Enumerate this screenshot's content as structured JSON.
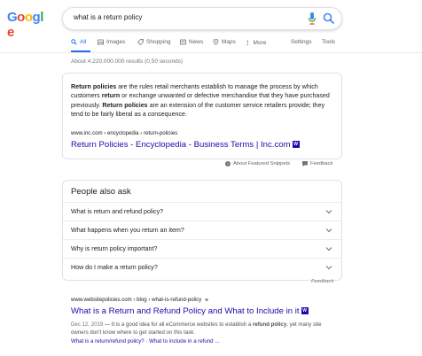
{
  "search": {
    "logo_letters": [
      {
        "ch": "G",
        "color": "#4285f4"
      },
      {
        "ch": "o",
        "color": "#ea4335"
      },
      {
        "ch": "o",
        "color": "#fbbc05"
      },
      {
        "ch": "g",
        "color": "#4285f4"
      },
      {
        "ch": "l",
        "color": "#34a853"
      },
      {
        "ch": "e",
        "color": "#ea4335"
      }
    ],
    "query": "what is a return policy"
  },
  "tabs": {
    "all": "All",
    "images": "Images",
    "shopping": "Shopping",
    "news": "News",
    "maps": "Maps",
    "more": "More",
    "settings": "Settings",
    "tools": "Tools"
  },
  "result_stats": "About 4.220.000.000 results (0,50 seconds)",
  "featured": {
    "snippet_parts": [
      {
        "text": "Return policies",
        "bold": true
      },
      {
        "text": " are the rules retail merchants establish to manage the process by which customers ",
        "bold": false
      },
      {
        "text": "return",
        "bold": true
      },
      {
        "text": " or exchange unwanted or defective merchandise that they have purchased previously. ",
        "bold": false
      },
      {
        "text": "Return policies",
        "bold": true
      },
      {
        "text": " are an extension of the customer service retailers provide; they tend to be fairly liberal as a consequence.",
        "bold": false
      }
    ],
    "cite": "www.inc.com › encyclopedia › return-policies",
    "title": "Return Policies - Encyclopedia - Business Terms | Inc.com",
    "favicon_letter": "W",
    "about_label": "About Featured Snippets",
    "feedback_label": "Feedback"
  },
  "paa": {
    "title": "People also ask",
    "questions": [
      "What is return and refund policy?",
      "What happens when you return an item?",
      "Why is return policy important?",
      "How do I make a return policy?"
    ],
    "feedback_label": "Feedback"
  },
  "result": {
    "cite": "www.websitepolicies.com › blog › what-is-refund-policy",
    "title": "What is a Return and Refund Policy and What to Include in it",
    "favicon_letter": "W",
    "date": "Dec 12, 2019",
    "snippet_a": " — It is a good idea for all eCommerce websites to establish a ",
    "snippet_bold": "refund policy",
    "snippet_b": ", yet many site owners don't know where to get started on this task.",
    "link1": "What is a return/refund policy?",
    "link_sep": " · ",
    "link2": "What to include in a refund ..."
  },
  "colors": {
    "link": "#1a0dab",
    "accent_blue": "#1a73e8",
    "border": "#dfe1e5"
  }
}
